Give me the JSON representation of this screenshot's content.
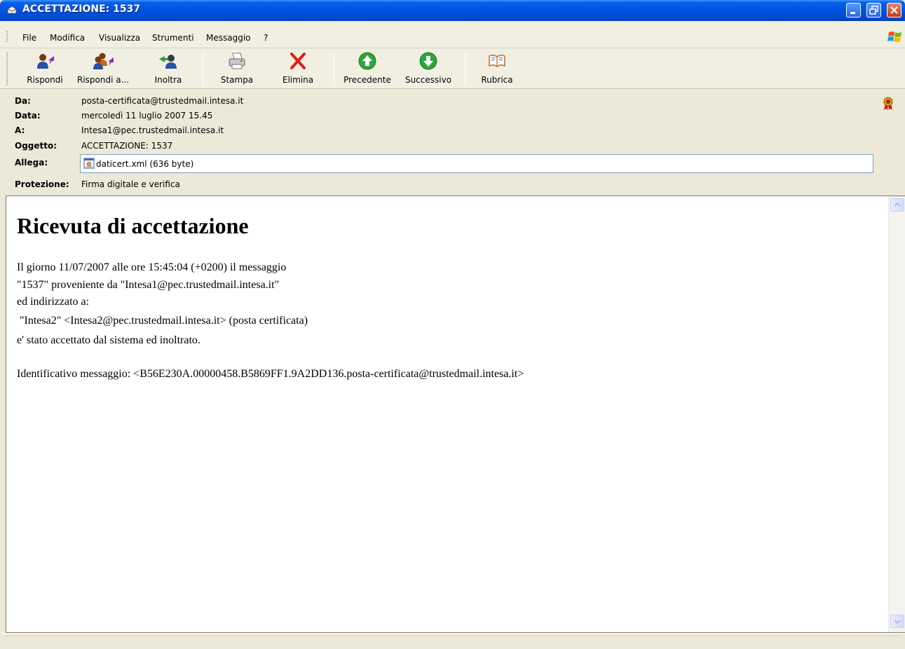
{
  "window": {
    "title": "ACCETTAZIONE: 1537",
    "controls": [
      "minimize-icon",
      "restore-icon",
      "close-icon"
    ]
  },
  "menu": {
    "items": [
      "File",
      "Modifica",
      "Visualizza",
      "Strumenti",
      "Messaggio",
      "?"
    ]
  },
  "toolbar": {
    "buttons": [
      {
        "label": "Rispondi",
        "icon": "reply-icon"
      },
      {
        "label": "Rispondi a...",
        "icon": "reply-all-icon"
      },
      {
        "label": "Inoltra",
        "icon": "forward-icon"
      },
      {
        "label": "Stampa",
        "icon": "printer-icon"
      },
      {
        "label": "Elimina",
        "icon": "delete-icon"
      },
      {
        "label": "Precedente",
        "icon": "arrow-up-icon"
      },
      {
        "label": "Successivo",
        "icon": "arrow-down-icon"
      },
      {
        "label": "Rubrica",
        "icon": "address-book-icon"
      }
    ]
  },
  "header": {
    "from_label": "Da:",
    "from": "posta-certificata@trustedmail.intesa.it",
    "date_label": "Data:",
    "date": "mercoledì 11 luglio 2007 15.45",
    "to_label": "A:",
    "to": "Intesa1@pec.trustedmail.intesa.it",
    "subject_label": "Oggetto:",
    "subject": "ACCETTAZIONE: 1537",
    "attach_label": "Allega:",
    "attachment": "daticert.xml (636 byte)",
    "security_label": "Protezione:",
    "security": "Firma digitale e verifica"
  },
  "message": {
    "title": "Ricevuta di accettazione",
    "lines": [
      "Il giorno 11/07/2007 alle ore 15:45:04 (+0200) il messaggio",
      "\"1537\" proveniente da \"Intesa1@pec.trustedmail.intesa.it\"",
      "ed indirizzato a:",
      " \"Intesa2\" <Intesa2@pec.trustedmail.intesa.it> (posta certificata)",
      "e' stato accettato dal sistema ed inoltrato.",
      "Identificativo messaggio: <B56E230A.00000458.B5869FF1.9A2DD136.posta-certificata@trustedmail.intesa.it>"
    ]
  },
  "colors": {
    "titlebar": "#0054E3",
    "window_bg": "#ECE9D8",
    "delete_red": "#E02010",
    "nav_green": "#2EA63A"
  }
}
